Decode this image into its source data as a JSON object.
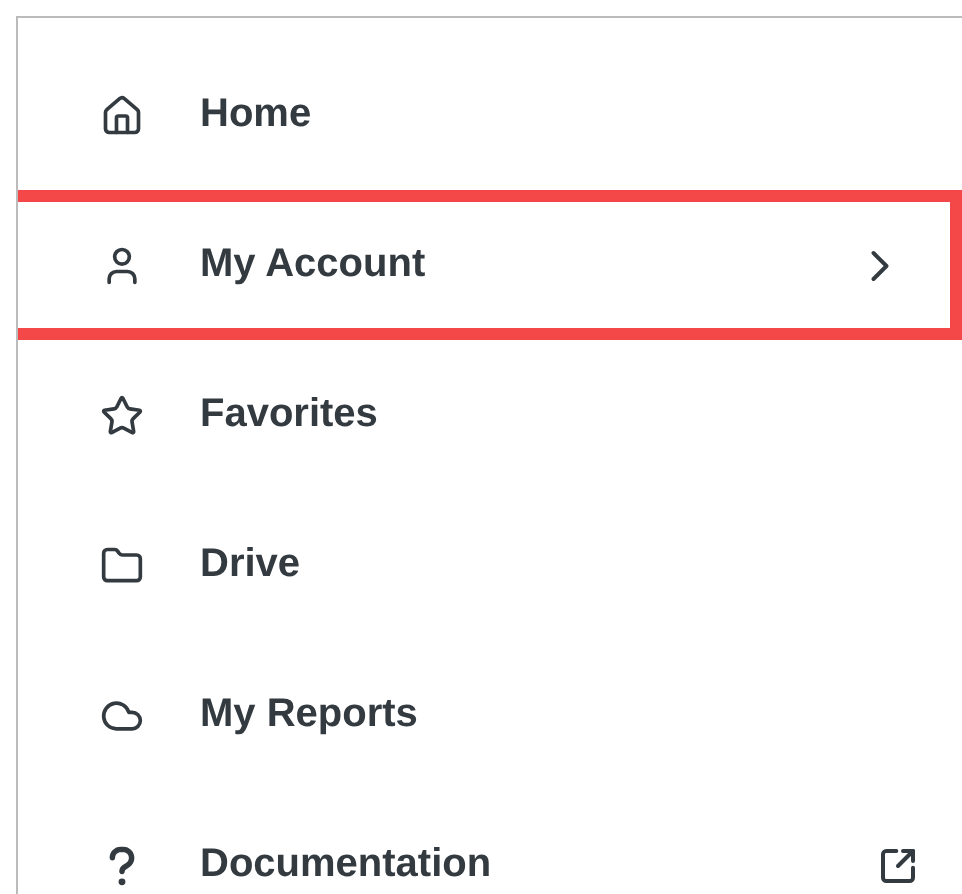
{
  "menu": {
    "items": [
      {
        "label": "Home",
        "kind": "link",
        "selected": false
      },
      {
        "label": "My Account",
        "kind": "submenu",
        "selected": true
      },
      {
        "label": "Favorites",
        "kind": "link",
        "selected": false
      },
      {
        "label": "Drive",
        "kind": "link",
        "selected": false
      },
      {
        "label": "My Reports",
        "kind": "link",
        "selected": false
      },
      {
        "label": "Documentation",
        "kind": "external",
        "selected": false
      }
    ]
  }
}
